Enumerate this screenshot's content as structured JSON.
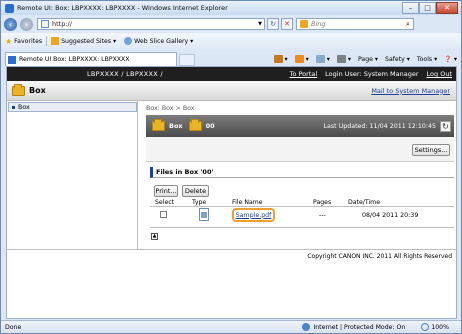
{
  "window": {
    "title": "Remote UI: Box: LBPXXXX: LBPXXXX - Windows Internet Explorer",
    "controls": {
      "minimize": "–",
      "maximize": "□",
      "close": "✕"
    }
  },
  "address_bar": {
    "url": "http://",
    "refresh_symbol": "↻",
    "stop_symbol": "✕"
  },
  "search": {
    "placeholder": "Bing",
    "go_symbol": "⌕"
  },
  "favorites_bar": {
    "favorites_label": "Favorites",
    "items": [
      {
        "label": "Suggested Sites ▾",
        "icon": "suggested-sites-icon"
      },
      {
        "label": "Web Slice Gallery ▾",
        "icon": "web-slice-icon"
      }
    ]
  },
  "tab": {
    "label": "Remote UI Box: LBPXXXX: LBPXXXX"
  },
  "command_bar": {
    "items": [
      {
        "label": "▾",
        "icon": "home-icon"
      },
      {
        "label": "▾",
        "icon": "feeds-icon"
      },
      {
        "label": "▾",
        "icon": "mail-icon"
      },
      {
        "label": "▾",
        "icon": "print-icon"
      },
      {
        "label": "Page ▾",
        "icon": ""
      },
      {
        "label": "Safety ▾",
        "icon": ""
      },
      {
        "label": "Tools ▾",
        "icon": ""
      },
      {
        "label": "❓ ▾",
        "icon": ""
      }
    ]
  },
  "page": {
    "device_name": "LBPXXXX / LBPXXXX /",
    "to_portal": "To Portal",
    "login_user": "Login User: System Manager",
    "log_out": "Log Out",
    "header_title": "Box",
    "mail_link": "Mail to System Manager",
    "nav": {
      "items": [
        {
          "label": "Box"
        }
      ]
    },
    "breadcrumb": "Box: Box > Box",
    "box_bar": {
      "label": "Box",
      "number": "00",
      "last_updated": "Last Updated: 11/04 2011 12:10:45",
      "refresh_symbol": "↻"
    },
    "settings_button": "Settings...",
    "files_heading": "Files in Box '00'",
    "print_button": "Print...",
    "delete_button": "Delete",
    "table": {
      "headers": [
        "Select",
        "Type",
        "File Name",
        "Pages",
        "Date/Time"
      ],
      "rows": [
        {
          "file_name": "Sample.pdf",
          "pages": "---",
          "datetime": "08/04 2011 20:39",
          "selected": false
        }
      ]
    },
    "copyright": "Copyright CANON INC. 2011 All Rights Reserved"
  },
  "status_bar": {
    "status": "Done",
    "zone": "Internet | Protected Mode: On",
    "zoom": "100%"
  },
  "colors": {
    "accent_link": "#1b3f9c",
    "highlight_ring": "#f0a030",
    "top_band": "#1f1f1f"
  }
}
